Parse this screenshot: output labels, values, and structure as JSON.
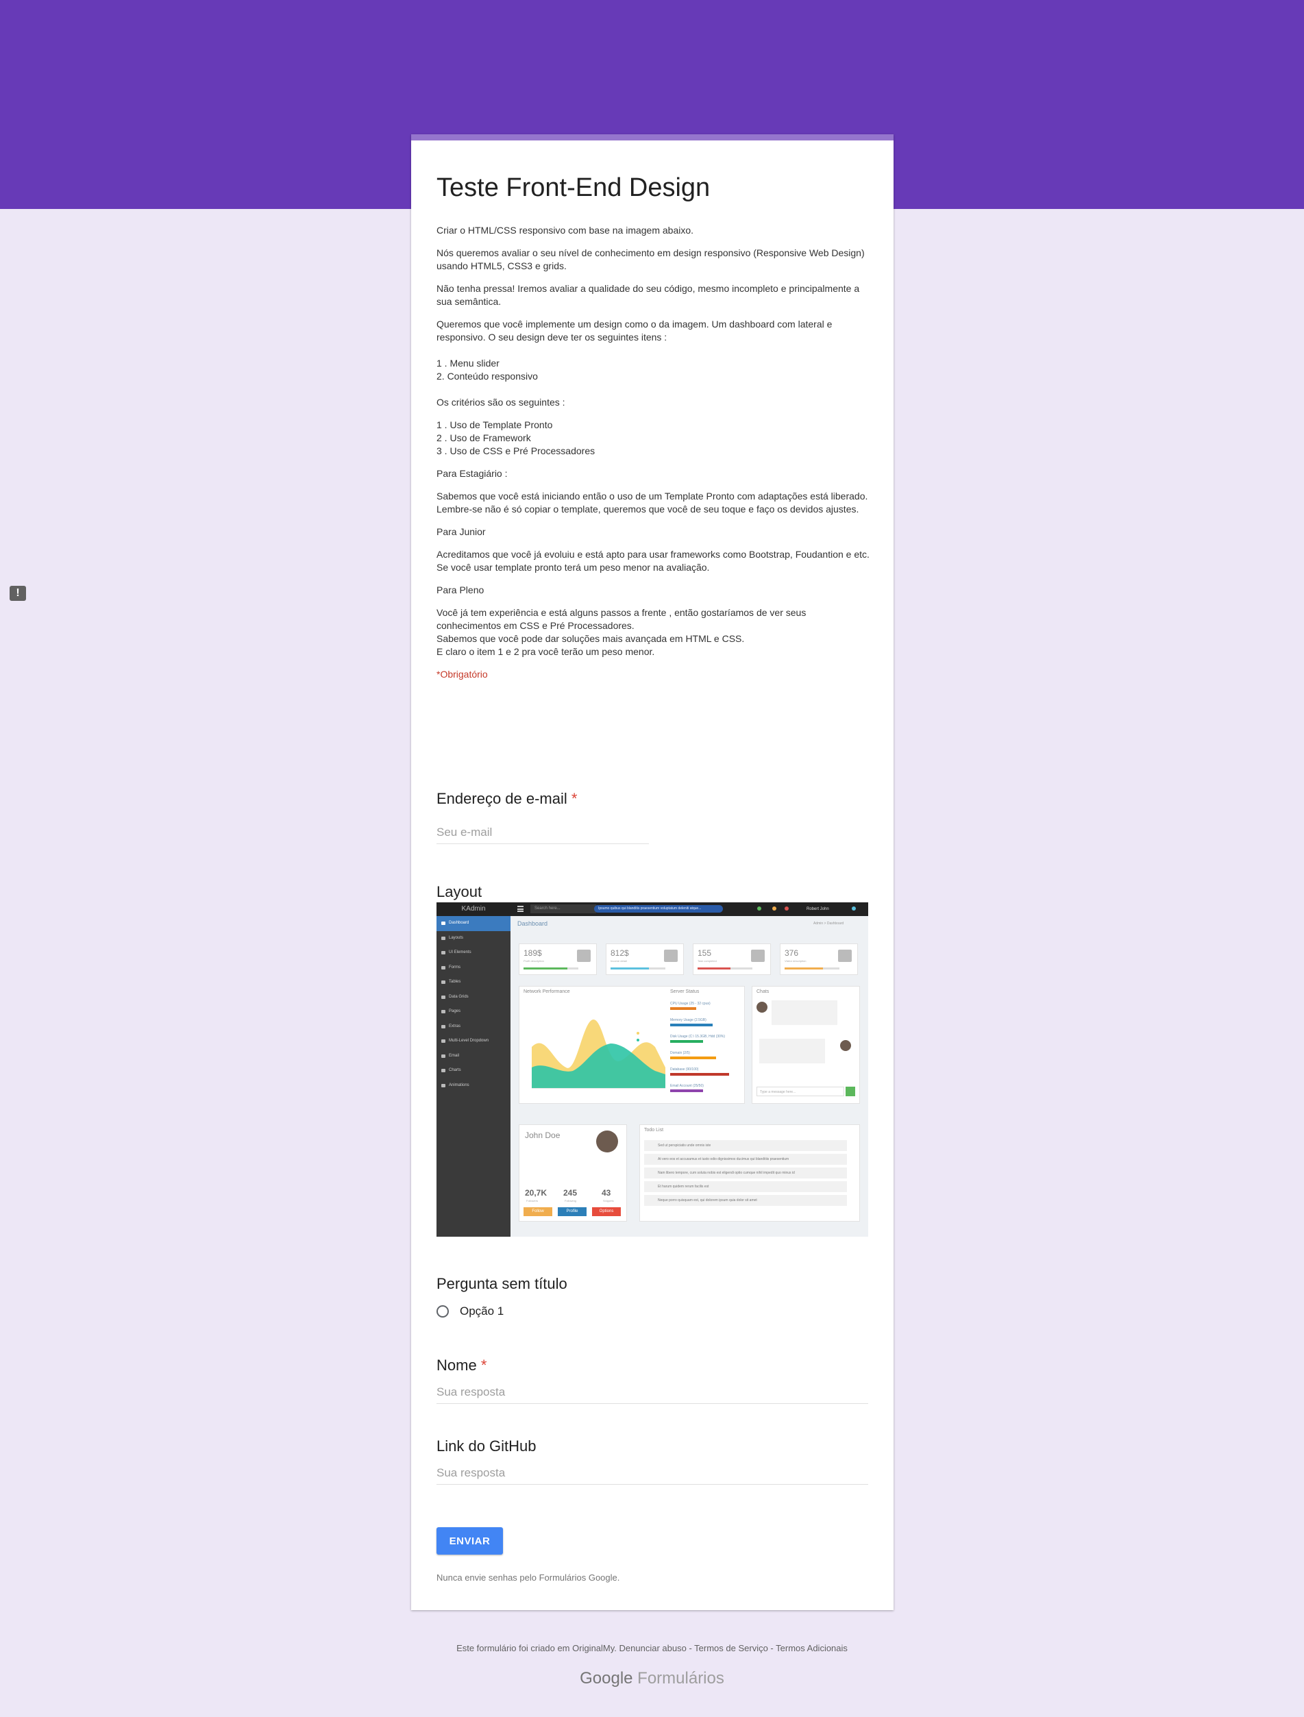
{
  "form": {
    "title": "Teste Front-End Design",
    "description": [
      "Criar o HTML/CSS responsivo com base na imagem abaixo.",
      "Nós queremos avaliar o seu nível de conhecimento em design responsivo (Responsive Web Design) usando HTML5, CSS3 e grids.",
      "Não tenha pressa! Iremos avaliar a qualidade do seu código, mesmo incompleto e principalmente a sua semântica.",
      "Queremos que você implemente um design como o da imagem. Um dashboard com lateral e responsivo. O seu design deve ter os seguintes itens :",
      "\n1 . Menu slider\n2. Conteúdo responsivo\n\n",
      "Os critérios são os seguintes :",
      "1 . Uso de Template Pronto\n2 . Uso de Framework\n3 . Uso de CSS e Pré Processadores",
      "Para Estagiário :",
      "Sabemos que você está iniciando então o uso de um Template Pronto com adaptações está liberado. Lembre-se não é só copiar o template, queremos que você de seu toque e faço os devidos ajustes.\n",
      "Para Junior",
      "Acreditamos que você já evoluiu e está apto para usar frameworks como Bootstrap, Foudantion e etc.\nSe você usar template pronto terá um peso menor na avaliação.\n",
      "Para Pleno",
      "Você já tem experiência e está alguns passos a frente , então gostaríamos de ver seus conhecimentos em CSS e Pré Processadores.\nSabemos que você pode dar soluções mais avançada em HTML e CSS.\nE claro o item 1 e 2 pra você terão um peso menor."
    ],
    "required_note": "*Obrigatório",
    "questions": {
      "email": {
        "title": "Endereço de e-mail",
        "required_mark": "*",
        "placeholder": "Seu e-mail"
      },
      "layout": {
        "title": "Layout"
      },
      "untitled": {
        "title": "Pergunta sem título",
        "option": "Opção 1"
      },
      "name": {
        "title": "Nome",
        "required_mark": "*",
        "placeholder": "Sua resposta"
      },
      "github": {
        "title": "Link do GitHub",
        "placeholder": "Sua resposta"
      }
    },
    "submit_label": "ENVIAR",
    "disclaimer": "Nunca envie senhas pelo Formulários Google."
  },
  "footer": {
    "created_in": "Este formulário foi criado em OriginalMy.",
    "report": "Denunciar abuso",
    "terms": "Termos de Serviço",
    "additional": "Termos Adicionais",
    "sep": " - ",
    "logo_google": "Google",
    "logo_forms": "Formulários"
  },
  "dashboard_image": {
    "brand": "KAdmin",
    "search": "Search here...",
    "ticker": "Ipsumo quibus qui blanditis praesentium voluptatum deleniti atque...",
    "user": "Robert John",
    "heading": "Dashboard",
    "breadcrumb": "Admin  >  Dashboard",
    "menu": [
      "Dashboard",
      "Layouts",
      "UI Elements",
      "Forms",
      "Tables",
      "Data Grids",
      "Pages",
      "Extras",
      "Multi-Level Dropdown",
      "Email",
      "Charts",
      "Animations"
    ],
    "stats": [
      {
        "value": "189$",
        "sub": "Profit description",
        "fill": 0.8,
        "color": "#5cb85c"
      },
      {
        "value": "812$",
        "sub": "Income detail",
        "fill": 0.7,
        "color": "#5bc0de"
      },
      {
        "value": "155",
        "sub": "Task completed",
        "fill": 0.6,
        "color": "#d9534f"
      },
      {
        "value": "376",
        "sub": "Visitor description",
        "fill": 0.7,
        "color": "#f0ad4e"
      }
    ],
    "network_title": "Network Performance",
    "server_title": "Server Status",
    "server_items": [
      {
        "label": "CPU Usage (25 - 32 cpus)",
        "fill": 0.4,
        "color": "#e67e22"
      },
      {
        "label": "Memory Usage (2.5GB)",
        "fill": 0.65,
        "color": "#2980b9"
      },
      {
        "label": "Disk Usage (C:\\ 15.3GB, Hdd (30%)",
        "fill": 0.5,
        "color": "#27ae60"
      },
      {
        "label": "Domain (2/5)",
        "fill": 0.7,
        "color": "#f39c12"
      },
      {
        "label": "Database (90/100)",
        "fill": 0.9,
        "color": "#c0392b"
      },
      {
        "label": "Email Account (25/50)",
        "fill": 0.5,
        "color": "#8e44ad"
      }
    ],
    "chats_title": "Chats",
    "chat_input": "Type a message here...",
    "profile_name": "John Doe",
    "profile_stats": [
      {
        "value": "20,7K",
        "label": "Followers"
      },
      {
        "value": "245",
        "label": "Following"
      },
      {
        "value": "43",
        "label": "Snippets"
      }
    ],
    "profile_buttons": [
      {
        "label": "Follow",
        "color": "#f0ad4e"
      },
      {
        "label": "Profile",
        "color": "#2c7fb8"
      },
      {
        "label": "Options",
        "color": "#e74c3c"
      }
    ],
    "todo_title": "Todo List",
    "todo_items": [
      "Sed ut perspiciatis unde omnis iste",
      "At vero eos et accusamus et iusto odio dignissimos ducimus qui blanditiis praesentium",
      "Nam libero tempore, cum soluta nobis est eligendi optio cumque nihil impedit quo minus id",
      "Et harum quidem rerum facilis est",
      "Neque porro quisquam est, qui dolorem ipsum quia dolor sit amet"
    ]
  }
}
